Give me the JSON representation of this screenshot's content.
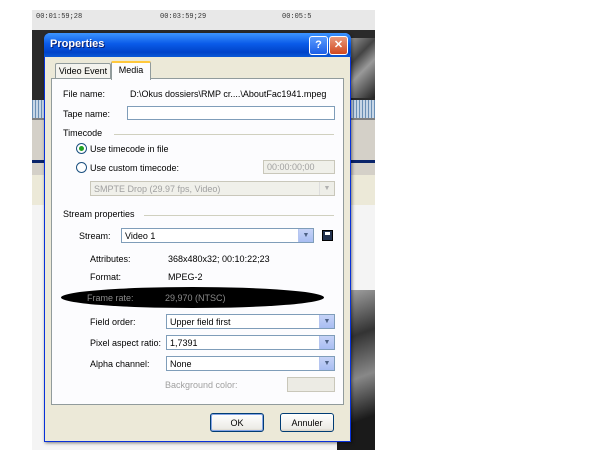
{
  "background": {
    "timeline_times": [
      "00:01:59;28",
      "00:03:59;29",
      "00:05:5"
    ]
  },
  "dialog": {
    "title": "Properties",
    "help_label": "?",
    "close_label": "✕",
    "tabs": [
      {
        "label": "Video Event",
        "active": false
      },
      {
        "label": "Media",
        "active": true
      }
    ],
    "file_name_label": "File name:",
    "file_name_value": "D:\\Okus dossiers\\RMP cr....\\AboutFac1941.mpeg",
    "tape_name_label": "Tape name:",
    "tape_name_value": "",
    "timecode_group": "Timecode",
    "use_timecode_in_file": "Use timecode in file",
    "use_custom_timecode": "Use custom timecode:",
    "custom_timecode_value": "00:00:00;00",
    "timecode_format": "SMPTE Drop (29.97 fps, Video)",
    "stream_group": "Stream properties",
    "stream_label": "Stream:",
    "stream_value": "Video 1",
    "attributes_label": "Attributes:",
    "attributes_value": "368x480x32; 00:10:22;23",
    "format_label": "Format:",
    "format_value": "MPEG-2",
    "frame_rate_label": "Frame rate:",
    "frame_rate_value": "29,970 (NTSC)",
    "field_order_label": "Field order:",
    "field_order_value": "Upper field first",
    "pixel_aspect_label": "Pixel aspect ratio:",
    "pixel_aspect_value": "1,7391",
    "alpha_channel_label": "Alpha channel:",
    "alpha_channel_value": "None",
    "background_color_label": "Background color:",
    "ok_label": "OK",
    "cancel_label": "Annuler"
  },
  "icons": {
    "dropdown": "chevron-down-icon",
    "save": "floppy-disk-icon",
    "radio_selected": "radio-selected-icon",
    "radio_unselected": "radio-unselected-icon"
  },
  "colors": {
    "title_bar": "#0a5be8",
    "close_button": "#d2481e",
    "dialog_bg": "#ece9d8",
    "tab_highlight": "#ffc83c",
    "highlight_oval": "#000000"
  }
}
